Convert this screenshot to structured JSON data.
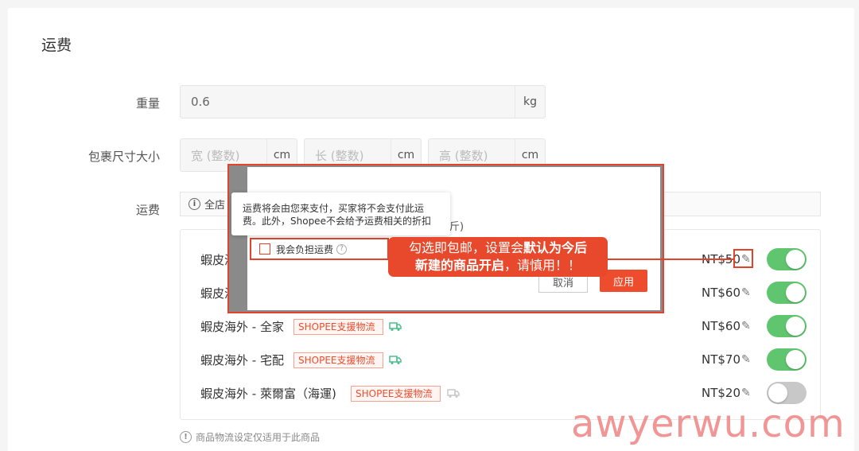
{
  "section_title": "运费",
  "weight": {
    "label": "重量",
    "value": "0.6",
    "unit": "kg"
  },
  "package_size": {
    "label": "包裹尺寸大小",
    "width": {
      "placeholder": "宽 (整数)",
      "unit": "cm"
    },
    "length": {
      "placeholder": "长 (整数)",
      "unit": "cm"
    },
    "height": {
      "placeholder": "高 (整数)",
      "unit": "cm"
    }
  },
  "shipping": {
    "label": "运费",
    "info_text": "全店",
    "channels": [
      {
        "name": "蝦皮海外 - ",
        "tag": "",
        "price": "NT$50",
        "enabled": true
      },
      {
        "name": "蝦皮海外 - ",
        "tag": "",
        "price": "NT$60",
        "enabled": true
      },
      {
        "name": "蝦皮海外 - 全家",
        "tag": "SHOPEE支援物流",
        "price": "NT$60",
        "enabled": true
      },
      {
        "name": "蝦皮海外 - 宅配",
        "tag": "SHOPEE支援物流",
        "price": "NT$70",
        "enabled": true
      },
      {
        "name": "蝦皮海外 - 萊爾富（海運)",
        "tag": "SHOPEE支援物流",
        "price": "NT$20",
        "enabled": false
      }
    ]
  },
  "footnote": "商品物流设定仅适用于此商品",
  "dialog": {
    "partial_text": "斤)",
    "checkbox_label": "我会负担运费",
    "cancel_label": "取消",
    "apply_label": "应用"
  },
  "tooltip": {
    "line1": "运费将会由您来支付，买家将不会支付此运",
    "line2": "费。此外，Shopee不会给予运费相关的折扣"
  },
  "callout": {
    "line1_a": "勾选即包邮，设置会",
    "line1_b": "默认为今后",
    "line2_a": "新建的商品开启",
    "line2_b": "，请慎用！！"
  },
  "watermark": "awyerwu.com",
  "colors": {
    "accent": "#ee4d2d",
    "toggle_on": "#5fc56e",
    "toggle_off": "#c8c8c8"
  }
}
